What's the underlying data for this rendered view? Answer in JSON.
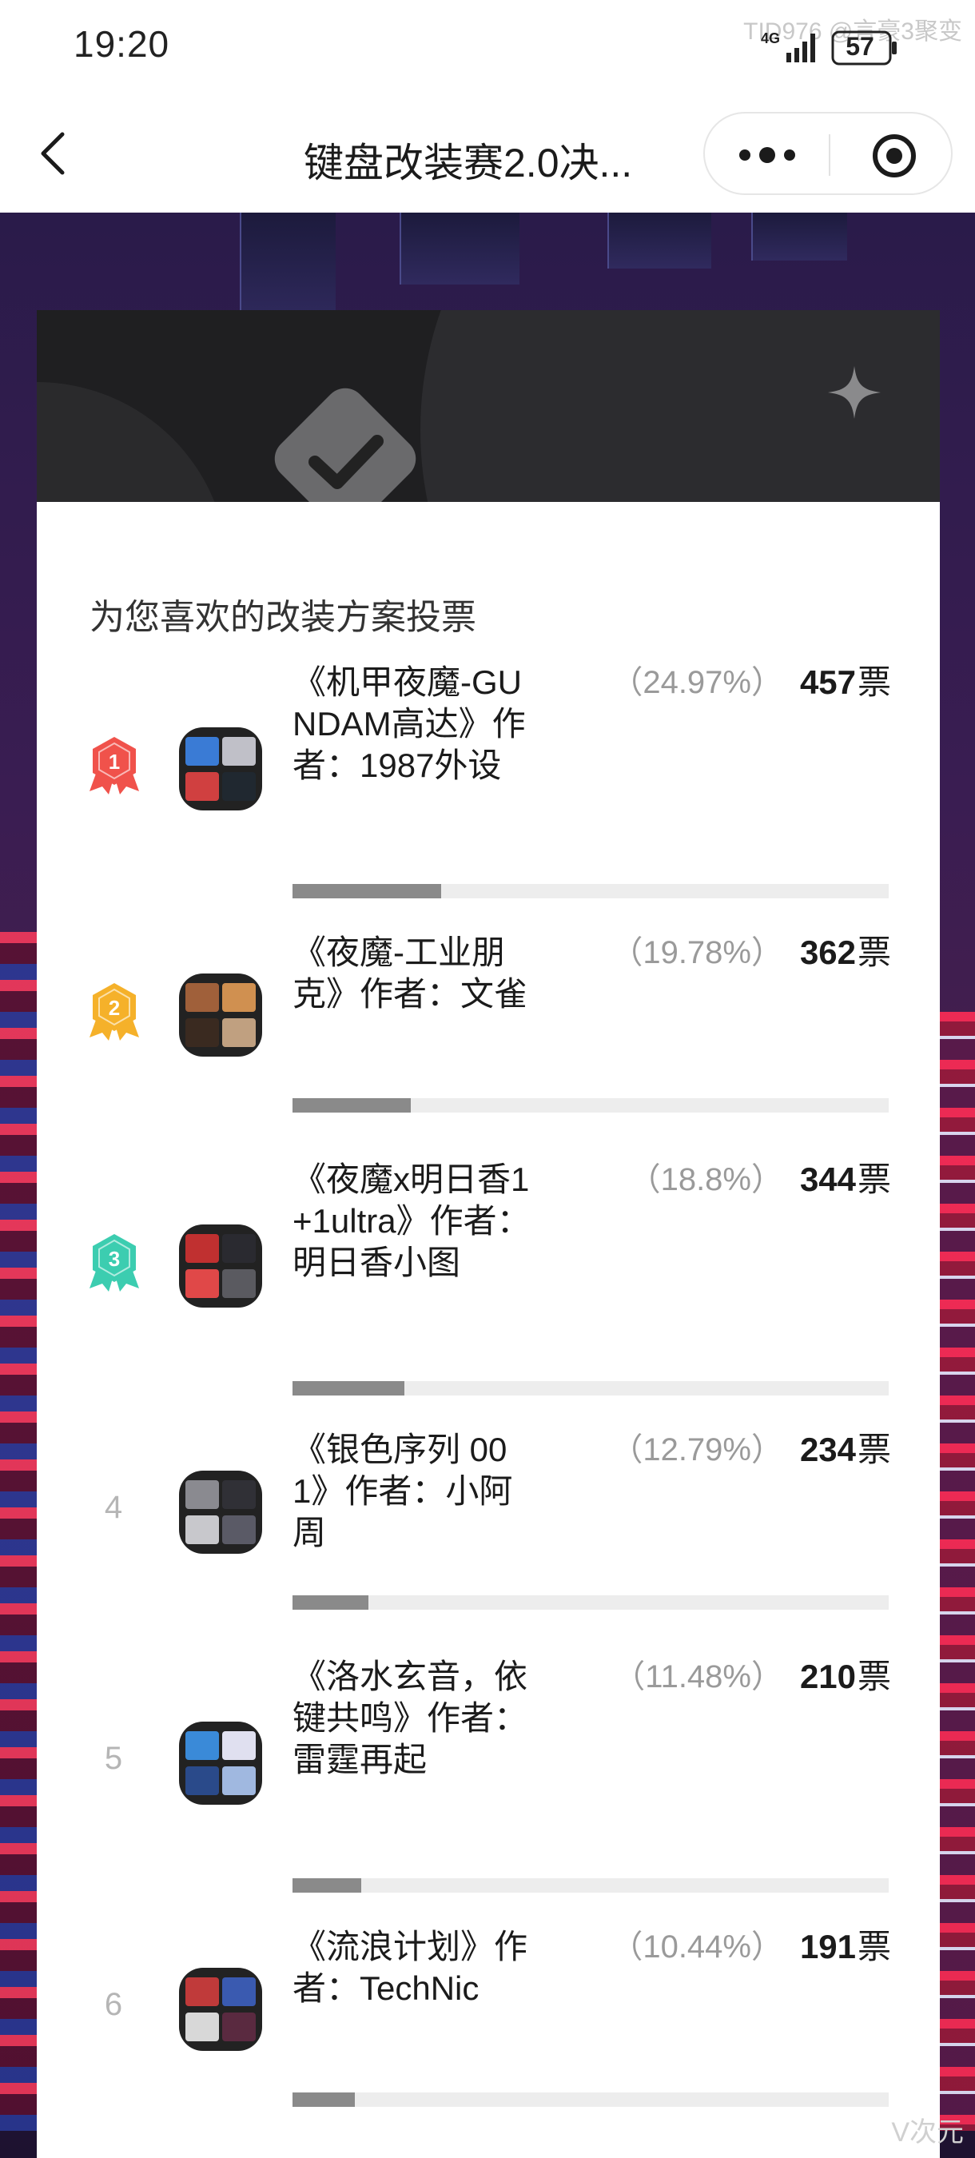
{
  "status_bar": {
    "time": "19:20",
    "network": "4G",
    "battery": "57",
    "watermark": "TID976 @言豪3聚变"
  },
  "nav": {
    "title": "键盘改装赛2.0决...",
    "more_icon": "more-dots-icon",
    "target_icon": "target-icon"
  },
  "card": {
    "subtitle": "为您喜欢的改装方案投票",
    "vote_unit": "票"
  },
  "items": [
    {
      "rank": "1",
      "badge_color": "#f0524b",
      "name": "《机甲夜魔-GUNDAM高达》作者：1987外设",
      "percent": "（24.97%）",
      "votes": "457",
      "share": 0.2497
    },
    {
      "rank": "2",
      "badge_color": "#f5b12a",
      "name": "《夜魔-工业朋克》作者：文雀",
      "percent": "（19.78%）",
      "votes": "362",
      "share": 0.1978
    },
    {
      "rank": "3",
      "badge_color": "#3ccdb0",
      "name": "《夜魔x明日香1+1ultra》作者：明日香小图",
      "percent": "（18.8%）",
      "votes": "344",
      "share": 0.188
    },
    {
      "rank": "4",
      "badge_color": "",
      "name": "《银色序列 001》作者：小阿周",
      "percent": "（12.79%）",
      "votes": "234",
      "share": 0.1279
    },
    {
      "rank": "5",
      "badge_color": "",
      "name": "《洛水玄音，依键共鸣》作者：雷霆再起",
      "percent": "（11.48%）",
      "votes": "210",
      "share": 0.1148
    },
    {
      "rank": "6",
      "badge_color": "",
      "name": "《流浪计划》作者：TechNic",
      "percent": "（10.44%）",
      "votes": "191",
      "share": 0.1044
    }
  ],
  "footer_watermark": "V次元"
}
